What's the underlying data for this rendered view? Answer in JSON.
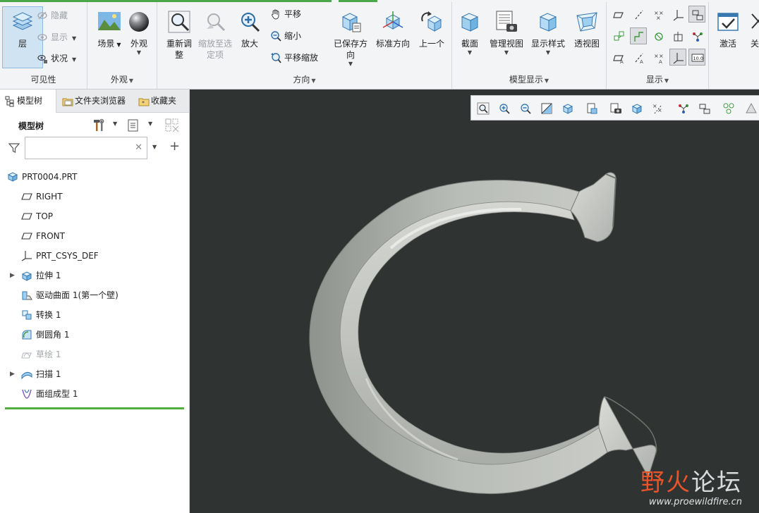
{
  "ribbon": {
    "visibility": {
      "group_label": "可见性",
      "layer_label": "层",
      "hide_label": "隐藏",
      "show_label": "显示",
      "status_label": "状况"
    },
    "appearance": {
      "group_label": "外观",
      "scene_label": "场景",
      "appearance_label": "外观"
    },
    "orientation": {
      "group_label": "方向",
      "refit_label": "重新调整",
      "zoom_to_selected_label": "缩放至选定项",
      "zoom_in_label": "放大",
      "pan_label": "平移",
      "zoom_out_label": "缩小",
      "pan_zoom_label": "平移缩放",
      "saved_orientations_label": "已保存方向",
      "standard_orientation_label": "标准方向",
      "previous_label": "上一个"
    },
    "model_display": {
      "group_label": "模型显示",
      "section_label": "截面",
      "manage_views_label": "管理视图",
      "display_style_label": "显示样式",
      "perspective_label": "透视图"
    },
    "show": {
      "group_label": "显示"
    },
    "window": {
      "activate_label": "激活",
      "close_label": "关"
    }
  },
  "left_panel": {
    "tabs": [
      "模型树",
      "文件夹浏览器",
      "收藏夹"
    ],
    "tree_title": "模型树",
    "filter_placeholder": "",
    "tree_nodes": [
      {
        "label": "PRT0004.PRT",
        "icon": "part-icon"
      },
      {
        "label": "RIGHT",
        "icon": "datum-plane-icon"
      },
      {
        "label": "TOP",
        "icon": "datum-plane-icon"
      },
      {
        "label": "FRONT",
        "icon": "datum-plane-icon"
      },
      {
        "label": "PRT_CSYS_DEF",
        "icon": "csys-icon"
      },
      {
        "label": "拉伸 1",
        "icon": "extrude-icon",
        "expandable": true
      },
      {
        "label": "驱动曲面 1(第一个壁)",
        "icon": "driving-surface-icon"
      },
      {
        "label": "转换 1",
        "icon": "conversion-icon"
      },
      {
        "label": "倒圆角 1",
        "icon": "round-icon"
      },
      {
        "label": "草绘 1",
        "icon": "sketch-icon",
        "dim": true
      },
      {
        "label": "扫描 1",
        "icon": "sweep-icon",
        "expandable": true
      },
      {
        "label": "面组成型 1",
        "icon": "quilt-form-icon"
      }
    ]
  },
  "viewport": {
    "background_color": "#2f3433",
    "watermark_cn_1": "野",
    "watermark_cn_2": "火",
    "watermark_cn_3": "论坛",
    "watermark_url": "www.proewildfire.cn"
  },
  "colors": {
    "accent_green": "#4fae3e",
    "active_blue": "#cfe3f3",
    "ribbon_bg": "#f3f4f5"
  }
}
